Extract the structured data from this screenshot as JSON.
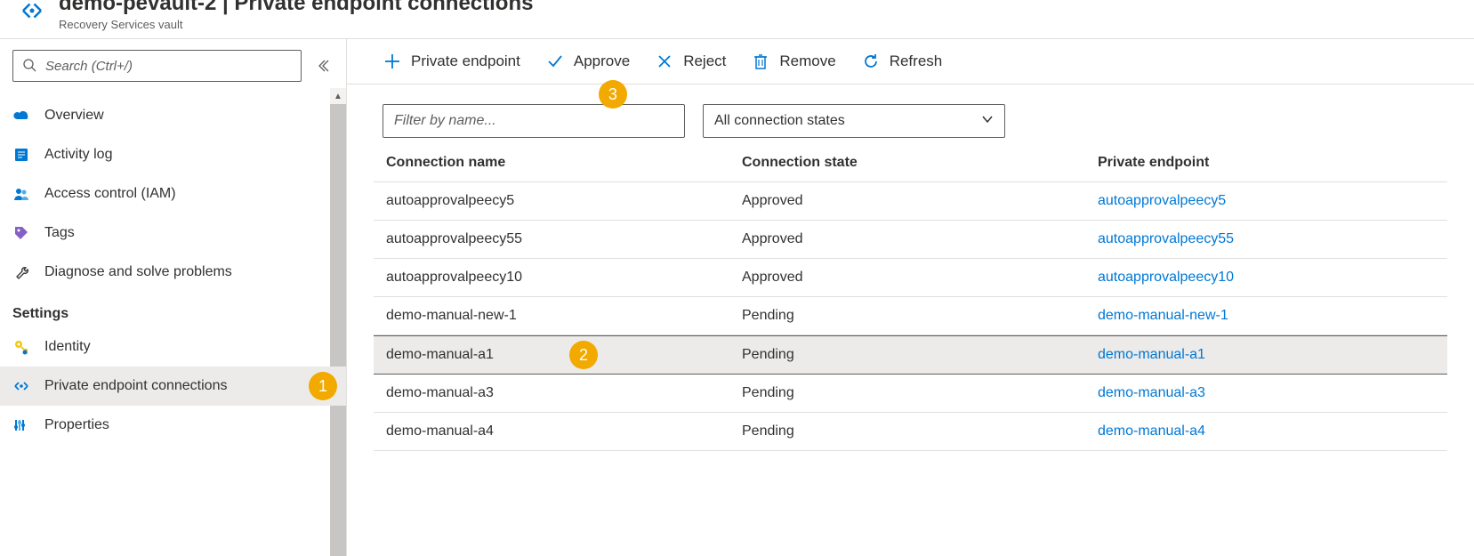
{
  "header": {
    "title": "demo-pevault-2 | Private endpoint connections",
    "subtitle": "Recovery Services vault"
  },
  "sidebar": {
    "search_placeholder": "Search (Ctrl+/)",
    "items_top": [
      {
        "label": "Overview",
        "icon": "cloud"
      },
      {
        "label": "Activity log",
        "icon": "log"
      },
      {
        "label": "Access control (IAM)",
        "icon": "people"
      },
      {
        "label": "Tags",
        "icon": "tag"
      },
      {
        "label": "Diagnose and solve problems",
        "icon": "wrench"
      }
    ],
    "section_label": "Settings",
    "items_settings": [
      {
        "label": "Identity",
        "icon": "key"
      },
      {
        "label": "Private endpoint connections",
        "icon": "endpoint",
        "selected": true
      },
      {
        "label": "Properties",
        "icon": "props"
      }
    ]
  },
  "toolbar": {
    "private_endpoint": "Private endpoint",
    "approve": "Approve",
    "reject": "Reject",
    "remove": "Remove",
    "refresh": "Refresh"
  },
  "filters": {
    "filter_placeholder": "Filter by name...",
    "state_label": "All connection states"
  },
  "table": {
    "columns": {
      "name": "Connection name",
      "state": "Connection state",
      "endpoint": "Private endpoint"
    },
    "rows": [
      {
        "name": "autoapprovalpeecy5",
        "state": "Approved",
        "endpoint": "autoapprovalpeecy5"
      },
      {
        "name": "autoapprovalpeecy55",
        "state": "Approved",
        "endpoint": "autoapprovalpeecy55"
      },
      {
        "name": "autoapprovalpeecy10",
        "state": "Approved",
        "endpoint": "autoapprovalpeecy10"
      },
      {
        "name": "demo-manual-new-1",
        "state": "Pending",
        "endpoint": "demo-manual-new-1"
      },
      {
        "name": "demo-manual-a1",
        "state": "Pending",
        "endpoint": "demo-manual-a1",
        "selected": true
      },
      {
        "name": "demo-manual-a3",
        "state": "Pending",
        "endpoint": "demo-manual-a3"
      },
      {
        "name": "demo-manual-a4",
        "state": "Pending",
        "endpoint": "demo-manual-a4"
      }
    ]
  },
  "callouts": {
    "c1": "1",
    "c2": "2",
    "c3": "3"
  }
}
